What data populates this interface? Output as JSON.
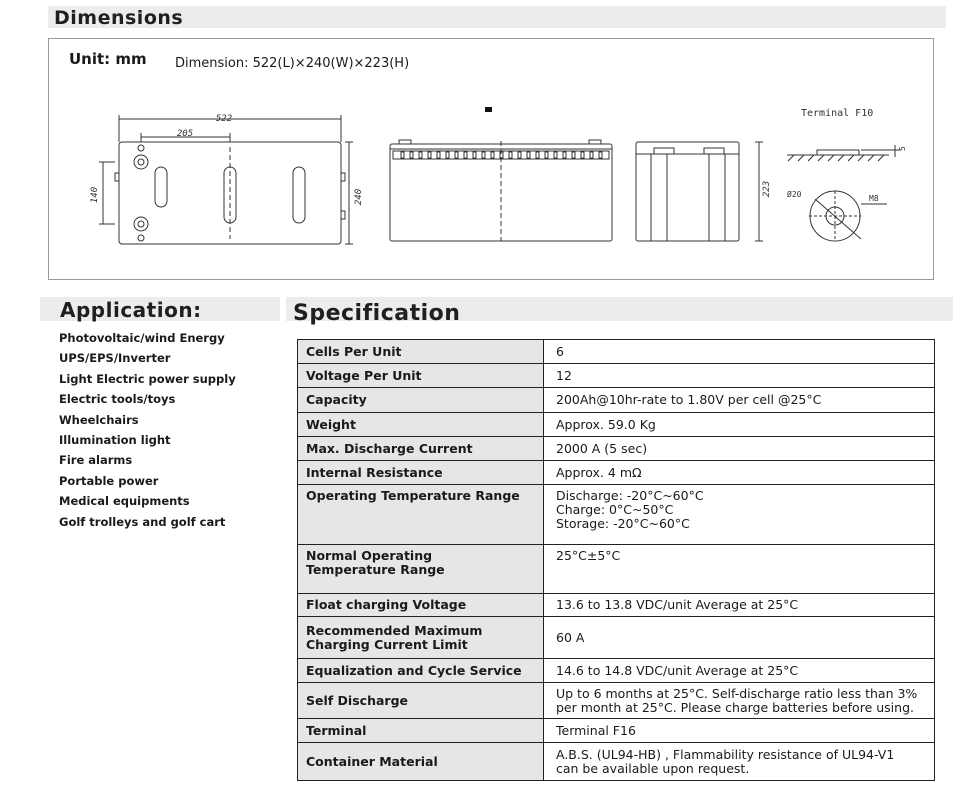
{
  "dimensions": {
    "heading": "Dimensions",
    "unit": "Unit: mm",
    "dimension_text": "Dimension: 522(L)×240(W)×223(H)",
    "drawing": {
      "length": "522",
      "terminal_spacing": "205",
      "width": "240",
      "height": "223",
      "mount_spacing": "140",
      "terminal_label": "Terminal F10",
      "terminal_height": "5",
      "terminal_diameter": "Ø20",
      "bolt": "M8"
    }
  },
  "application": {
    "heading": "Application:",
    "items": [
      "Photovoltaic/wind Energy",
      "UPS/EPS/Inverter",
      "Light Electric power supply",
      "Electric tools/toys",
      "Wheelchairs",
      "Illumination light",
      "Fire alarms",
      "Portable power",
      "Medical equipments",
      "Golf trolleys and golf cart"
    ]
  },
  "specification": {
    "heading": "Specification",
    "rows": [
      {
        "label": "Cells Per Unit",
        "value": "6"
      },
      {
        "label": "Voltage Per Unit",
        "value": "12"
      },
      {
        "label": "Capacity",
        "value": "200Ah@10hr-rate to 1.80V per cell @25°C"
      },
      {
        "label": "Weight",
        "value": "Approx. 59.0 Kg"
      },
      {
        "label": "Max. Discharge Current",
        "value": "2000 A (5 sec)"
      },
      {
        "label": "Internal Resistance",
        "value": "Approx. 4 mΩ"
      },
      {
        "label": "Operating Temperature Range",
        "value_lines": [
          "Discharge: -20°C~60°C",
          "Charge: 0°C~50°C",
          "Storage: -20°C~60°C"
        ]
      },
      {
        "label_lines": [
          "Normal Operating",
          "Temperature Range"
        ],
        "value": "25°C±5°C"
      },
      {
        "label": "Float charging Voltage",
        "value": "13.6 to 13.8 VDC/unit Average at 25°C"
      },
      {
        "label_lines": [
          "Recommended Maximum",
          "Charging Current Limit"
        ],
        "value": "60 A"
      },
      {
        "label": "Equalization and Cycle Service",
        "value": "14.6 to 14.8 VDC/unit Average at 25°C"
      },
      {
        "label": "Self Discharge",
        "value_lines": [
          "Up to 6 months at 25°C. Self-discharge ratio less than 3%",
          "per month at 25°C. Please charge batteries before using."
        ]
      },
      {
        "label": "Terminal",
        "value": "Terminal F16"
      },
      {
        "label": "Container Material",
        "value_lines": [
          "A.B.S. (UL94-HB) , Flammability resistance of UL94-V1",
          "can be available upon request."
        ]
      }
    ]
  }
}
